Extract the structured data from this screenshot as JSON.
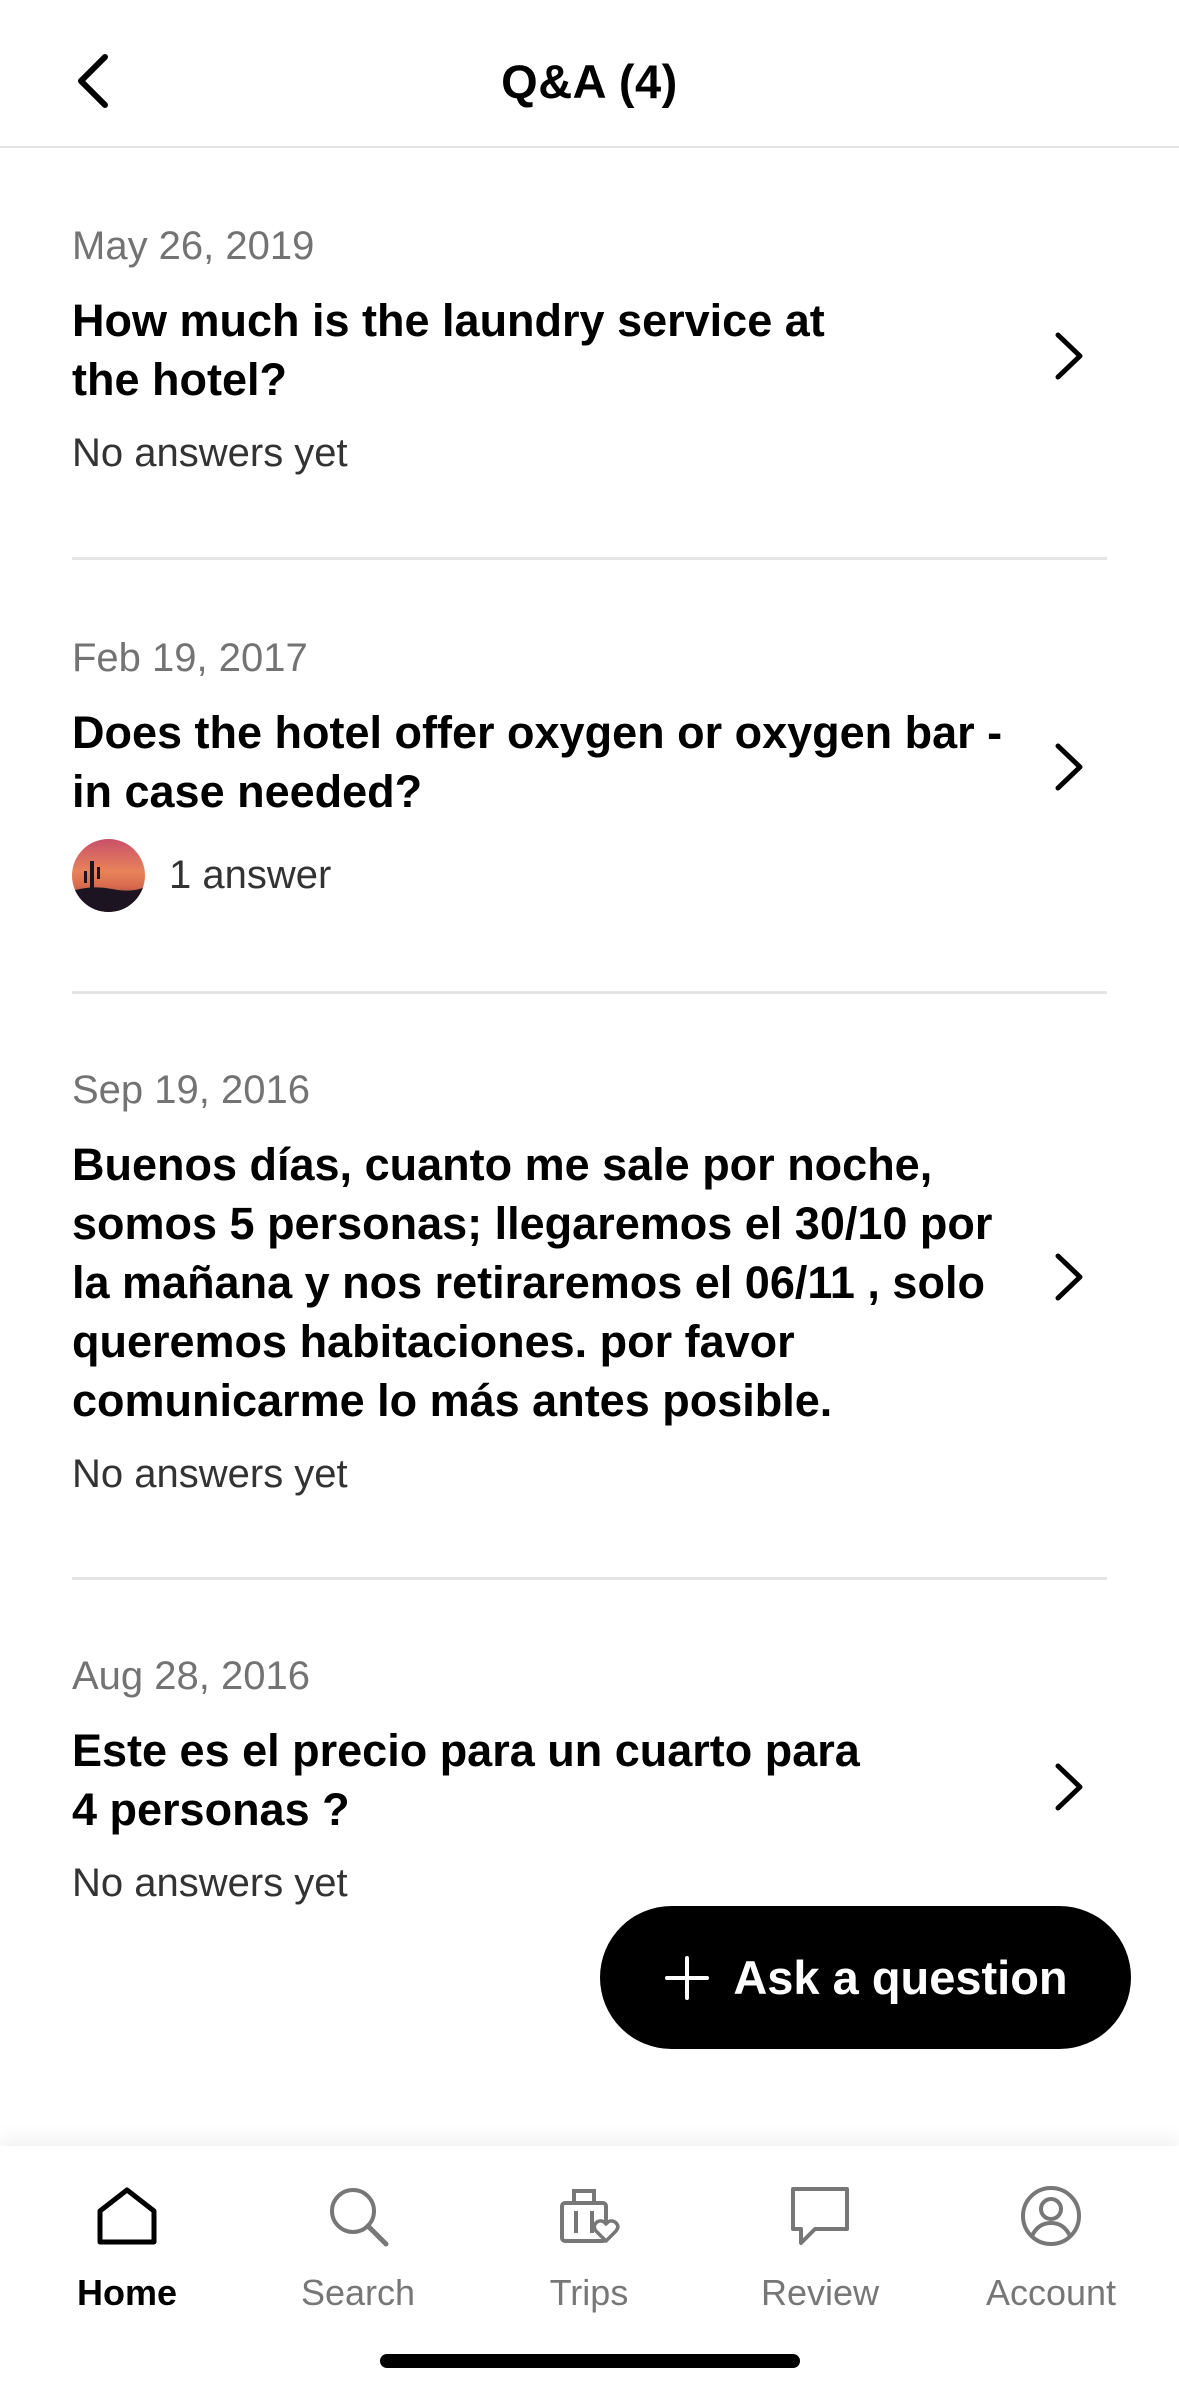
{
  "header": {
    "title": "Q&A (4)",
    "back_icon": "chevron-left-icon"
  },
  "questions": [
    {
      "date": "May 26, 2019",
      "question": "How much is the laundry service at the hotel?",
      "status": "No answers yet",
      "has_avatar": false
    },
    {
      "date": "Feb 19, 2017",
      "question": "Does the hotel offer oxygen or oxygen bar - in case needed?",
      "status": "1 answer",
      "has_avatar": true
    },
    {
      "date": "Sep 19, 2016",
      "question": "Buenos días,  cuanto me sale por noche, somos 5 personas; llegaremos el 30/10 por la mañana y nos retiraremos el 06/11 , solo queremos habitaciones.  por favor comunicarme lo más antes posible.",
      "status": "No answers yet",
      "has_avatar": false
    },
    {
      "date": "Aug 28, 2016",
      "question": "Este es el precio para un cuarto para 4 personas ?",
      "status": "No answers yet",
      "has_avatar": false
    }
  ],
  "ask_button": {
    "label": "Ask a question",
    "icon": "plus-icon"
  },
  "tabbar": {
    "items": [
      {
        "label": "Home",
        "icon": "home-icon",
        "active": true
      },
      {
        "label": "Search",
        "icon": "search-icon",
        "active": false
      },
      {
        "label": "Trips",
        "icon": "suitcase-heart-icon",
        "active": false
      },
      {
        "label": "Review",
        "icon": "speech-bubble-icon",
        "active": false
      },
      {
        "label": "Account",
        "icon": "user-circle-icon",
        "active": false
      }
    ]
  },
  "colors": {
    "text": "#000000",
    "muted": "#737373",
    "divider": "#e4e4e4",
    "button_bg": "#000000",
    "button_text": "#ffffff"
  }
}
